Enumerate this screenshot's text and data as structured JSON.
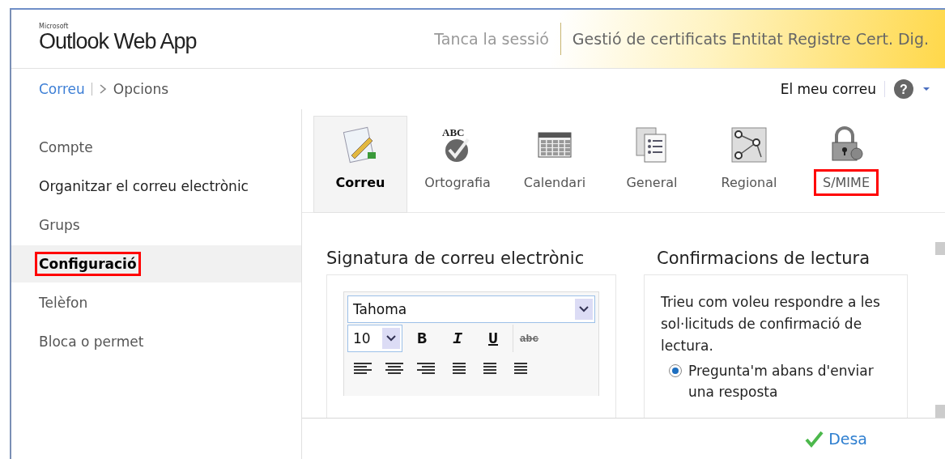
{
  "header": {
    "logo_small": "Microsoft",
    "logo": "Outlook Web App",
    "sign_out": "Tanca la sessió",
    "user": "Gestió de certificats Entitat Registre Cert. Dig."
  },
  "breadcrumb": {
    "items": [
      {
        "label": "Correu",
        "kind": "link"
      },
      {
        "label": "Opcions",
        "kind": "current"
      }
    ],
    "my_mail": "El meu correu",
    "help": "?"
  },
  "sidebar": {
    "items": [
      {
        "label": "Compte",
        "selected": false,
        "highlighted": false
      },
      {
        "label": "Organitzar el correu electrònic",
        "selected": false,
        "highlighted": false
      },
      {
        "label": "Grups",
        "selected": false,
        "highlighted": false
      },
      {
        "label": "Configuració",
        "selected": true,
        "highlighted": true
      },
      {
        "label": "Telèfon",
        "selected": false,
        "highlighted": false
      },
      {
        "label": "Bloca o permet",
        "selected": false,
        "highlighted": false
      }
    ]
  },
  "tabs": [
    {
      "label": "Correu",
      "kind": "mail",
      "selected": true,
      "highlighted": false
    },
    {
      "label": "Ortografia",
      "kind": "spelling",
      "icon_text": "ABC",
      "selected": false,
      "highlighted": false
    },
    {
      "label": "Calendari",
      "kind": "calendar",
      "selected": false,
      "highlighted": false
    },
    {
      "label": "General",
      "kind": "general",
      "selected": false,
      "highlighted": false
    },
    {
      "label": "Regional",
      "kind": "regional",
      "selected": false,
      "highlighted": false
    },
    {
      "label": "S/MIME",
      "kind": "smime",
      "selected": false,
      "highlighted": true
    }
  ],
  "signature": {
    "title": "Signatura de correu electrònic",
    "font": "Tahoma",
    "size": "10",
    "format_buttons": [
      {
        "label": "B",
        "kind": "bold"
      },
      {
        "label": "I",
        "kind": "italic"
      },
      {
        "label": "U",
        "kind": "underline"
      },
      {
        "label": "abc",
        "kind": "strike"
      }
    ]
  },
  "read_receipts": {
    "title": "Confirmacions de lectura",
    "text": "Trieu com voleu respondre a les sol·licituds de confirmació de lectura.",
    "options": [
      {
        "label": "Pregunta'm abans d'enviar una resposta",
        "selected": true
      }
    ]
  },
  "footer": {
    "save": "Desa"
  }
}
